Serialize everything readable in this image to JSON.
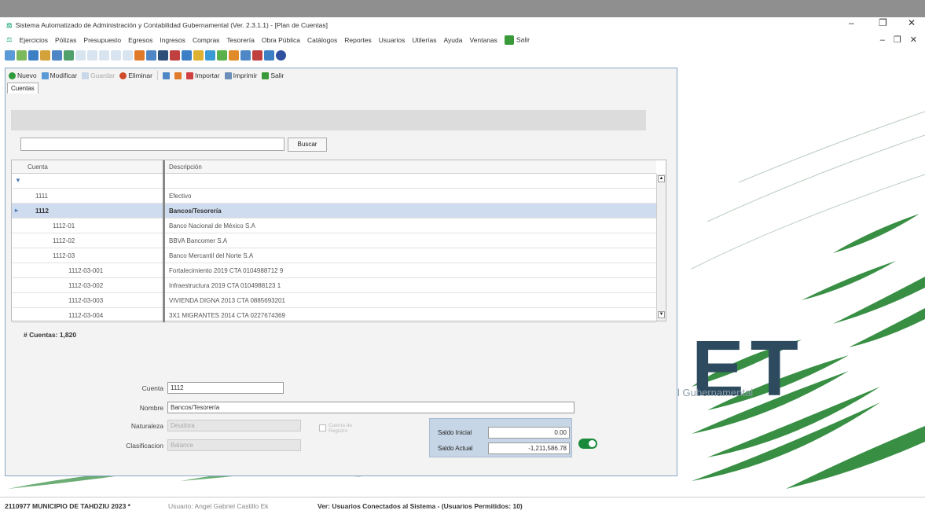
{
  "window": {
    "title": "Sistema Automatizado de Administración y Contabilidad Gubernamental (Ver. 2.3.1.1) - [Plan de Cuentas]",
    "controls": [
      "–",
      "❐",
      "✕"
    ]
  },
  "menu": {
    "items": [
      "Ejercicios",
      "Pólizas",
      "Presupuesto",
      "Egresos",
      "Ingresos",
      "Compras",
      "Tesorería",
      "Obra Pública",
      "Catálogos",
      "Reportes",
      "Usuarios",
      "Utilerías",
      "Ayuda",
      "Ventanas"
    ],
    "salir": "Salir",
    "right_controls": "– ❐ ✕"
  },
  "child_toolbar": {
    "nuevo": "Nuevo",
    "modificar": "Modificar",
    "guardar": "Guardar",
    "eliminar": "Eliminar",
    "importar": "Importar",
    "imprimir": "Imprimir",
    "salir": "Salir"
  },
  "tab": {
    "label": "Cuentas"
  },
  "search": {
    "value": "",
    "button": "Buscar"
  },
  "grid": {
    "headers": {
      "cuenta": "Cuenta",
      "descripcion": "Descripción"
    },
    "rows": [
      {
        "code": "",
        "desc": "",
        "indent": 0,
        "selected": false
      },
      {
        "code": "1111",
        "desc": "Efectivo",
        "indent": 20,
        "selected": false
      },
      {
        "code": "1112",
        "desc": "Bancos/Tesorería",
        "indent": 20,
        "selected": true
      },
      {
        "code": "1112-01",
        "desc": "Banco Nacional de México S.A",
        "indent": 42,
        "selected": false
      },
      {
        "code": "1112-02",
        "desc": "BBVA Bancomer S.A",
        "indent": 42,
        "selected": false
      },
      {
        "code": "1112-03",
        "desc": "Banco Mercantil del Norte S.A",
        "indent": 42,
        "selected": false
      },
      {
        "code": "1112-03-001",
        "desc": "Fortalecimiento 2019 CTA 0104988712 9",
        "indent": 62,
        "selected": false
      },
      {
        "code": "1112-03-002",
        "desc": "Infraestructura 2019 CTA 0104988123 1",
        "indent": 62,
        "selected": false
      },
      {
        "code": "1112-03-003",
        "desc": "VIVIENDA DIGNA 2013 CTA 0885693201",
        "indent": 62,
        "selected": false
      },
      {
        "code": "1112-03-004",
        "desc": "3X1 MIGRANTES 2014 CTA 0227674369",
        "indent": 62,
        "selected": false
      }
    ]
  },
  "count": {
    "label": "# Cuentas: 1,820"
  },
  "form": {
    "cuenta_label": "Cuenta",
    "cuenta_value": "1112",
    "nombre_label": "Nombre",
    "nombre_value": "Bancos/Tesorería",
    "naturaleza_label": "Naturaleza",
    "naturaleza_value": "Deudora",
    "clasificacion_label": "Clasificacion",
    "clasificacion_value": "Balance",
    "checkbox_label": "Cuenta de Registro",
    "saldo_inicial_label": "Saldo Inicial",
    "saldo_inicial_value": "0.00",
    "saldo_actual_label": "Saldo Actual",
    "saldo_actual_value": "-1,211,586.78"
  },
  "logo": {
    "text": "ET",
    "subtitle": "l Gubernamental"
  },
  "status": {
    "municipio": "2110977 MUNICIPIO DE TAHDZIU  2023  *",
    "usuario": "Usuario: Angel Gabriel Castillo Ek",
    "conectados": "Ver: Usuarios Conectados al Sistema - (Usuarios Permitidos: 10)"
  },
  "colors": {
    "selected_row": "#cfdcef",
    "toggle": "#1a8a3a",
    "logo": "#2d4a5e"
  }
}
